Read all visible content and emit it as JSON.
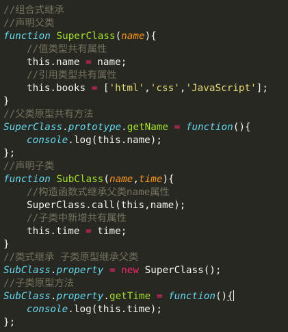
{
  "code": {
    "l1": "//组合式继承",
    "l2": "//声明父类",
    "l3": {
      "kw": "function",
      "name": "SuperClass",
      "open": "(",
      "param": "name",
      "close": "){"
    },
    "l4": "//值类型共有属性",
    "l5": {
      "this": "this.name",
      "eq": "=",
      "rhs": "name;"
    },
    "l6": "//引用类型共有属性",
    "l7": {
      "this": "this.books",
      "eq": "=",
      "open": "[",
      "s1": "'html'",
      "c1": ",",
      "s2": "'css'",
      "c2": ",",
      "s3": "'JavaScript'",
      "close": "];"
    },
    "l8": "}",
    "l9": "//父类原型共有方法",
    "l10": {
      "obj": "SuperClass",
      "dot1": ".",
      "prop": "prototype",
      "dot2": ".",
      "method": "getName",
      "eq": "=",
      "kw": "function",
      "rest": "(){"
    },
    "l11": {
      "obj": "console",
      "dot": ".",
      "method": "log",
      "rest": "(this.name);"
    },
    "l12": "};",
    "l13": "//声明子类",
    "l14": {
      "kw": "function",
      "name": "SubClass",
      "open": "(",
      "p1": "name",
      "comma": ",",
      "p2": "time",
      "close": "){"
    },
    "l15": "//构造函数式继承父类name属性",
    "l16": "SuperClass.call(this,name);",
    "l17": "//子类中新增共有属性",
    "l18": {
      "this": "this.time",
      "eq": "=",
      "rhs": "time;"
    },
    "l19": "}",
    "l20": "//类式继承 子类原型继承父类",
    "l21": {
      "obj": "SubClass",
      "dot": ".",
      "prop": "property",
      "eq": "=",
      "kw": "new",
      "rest": "SuperClass();"
    },
    "l22": "//子类原型方法",
    "l23": {
      "obj": "SubClass",
      "dot1": ".",
      "prop": "property",
      "dot2": ".",
      "method": "getTime",
      "eq": "=",
      "kw": "function",
      "paren": "()",
      "brace": "{"
    },
    "l24": {
      "obj": "console",
      "dot": ".",
      "method": "log",
      "rest": "(this.time);"
    },
    "l25": "};"
  },
  "colors": {
    "background": "#272822",
    "comment": "#75715e",
    "keyword": "#66d9ef",
    "function_name": "#a6e22e",
    "parameter": "#fd971f",
    "operator": "#f92672",
    "string": "#e6db74",
    "plain": "#f8f8f2"
  }
}
